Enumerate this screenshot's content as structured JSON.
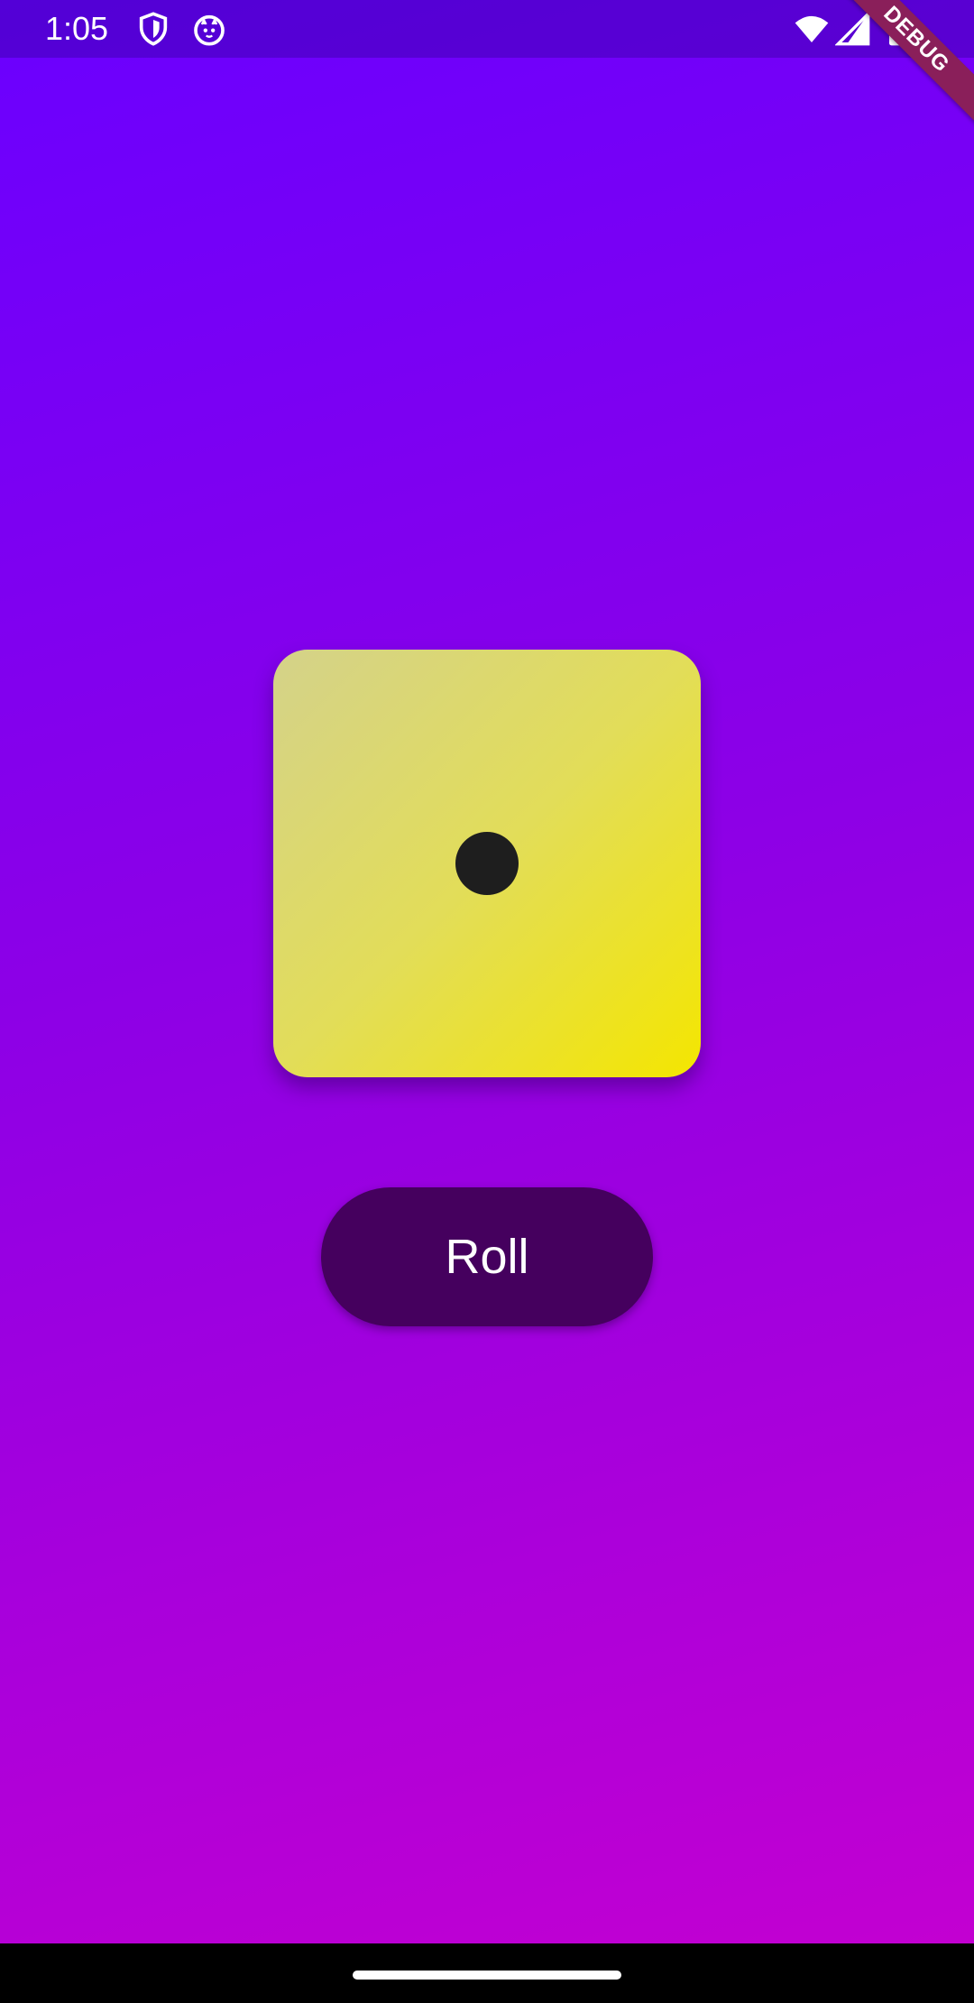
{
  "status_bar": {
    "time": "1:05",
    "icons": [
      "shield-icon",
      "cat-face-icon",
      "wifi-icon",
      "cell-signal-icon",
      "battery-icon"
    ]
  },
  "debug_banner": {
    "label": "DEBUG"
  },
  "die": {
    "face_value": 1,
    "pip_color": "#1e1e1e"
  },
  "roll_button": {
    "label": "Roll"
  },
  "colors": {
    "background_top": "#6a00ff",
    "background_bottom": "#c500d0",
    "die_light": "#d4d28a",
    "die_bright": "#f4e600",
    "button": "#45005e"
  }
}
